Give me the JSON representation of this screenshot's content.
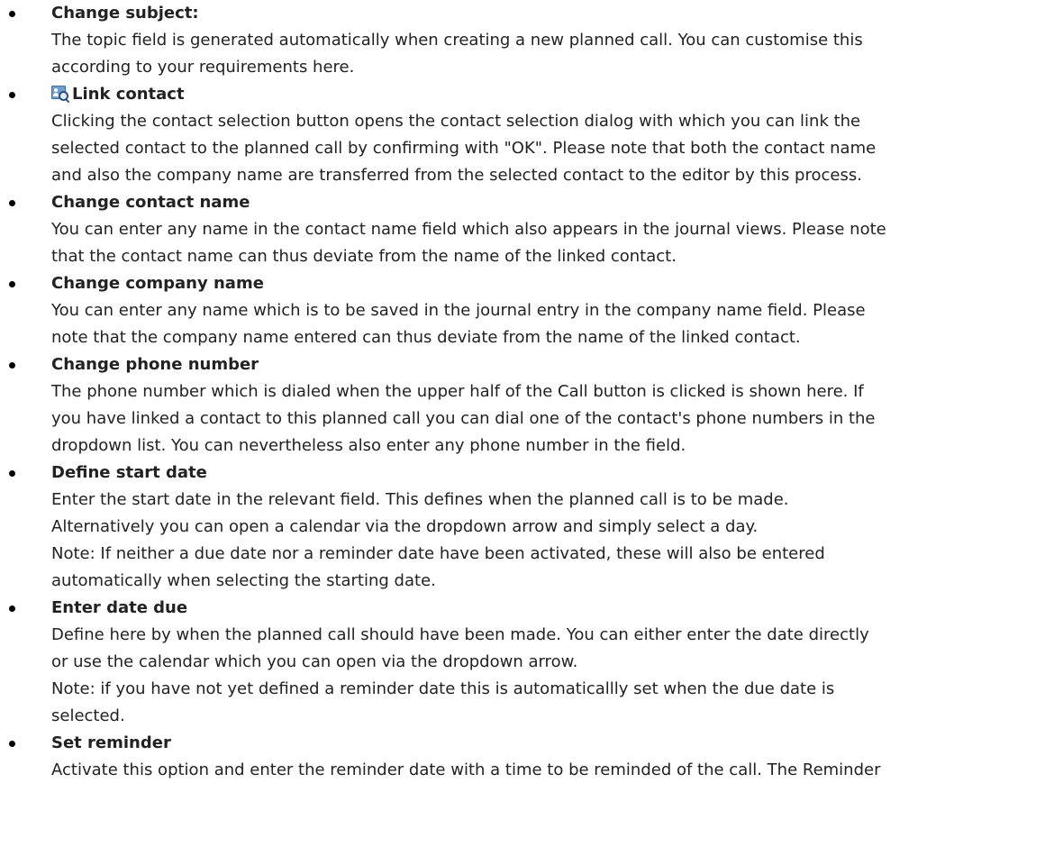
{
  "items": [
    {
      "title": "Change subject:",
      "lines": [
        "The topic field is generated automatically when creating a new planned call. You can customise this",
        "according to your requirements here."
      ]
    },
    {
      "title": "Link contact",
      "icon": "contact-search-icon",
      "lines": [
        "Clicking the contact selection button opens the contact selection dialog with which you can link the",
        "selected contact to the planned call by confirming with \"OK\". Please note that both the contact name",
        "and also the company name are transferred from the selected contact to the editor by this process."
      ]
    },
    {
      "title": "Change contact name",
      "lines": [
        "You can enter any name in the contact name field which also appears in the journal views. Please note",
        "that the contact name can thus deviate from the name of the linked contact."
      ]
    },
    {
      "title": "Change company name",
      "lines": [
        "You can enter any name which is to be saved in the journal entry in the company name field. Please",
        "note that the company name entered can thus deviate from the name of the linked contact."
      ]
    },
    {
      "title": "Change phone number",
      "lines": [
        "The phone number which is dialed when the upper half of the Call button is clicked is shown here. If",
        "you have linked a contact to this planned call you can dial one of the contact's phone numbers in the",
        "dropdown list. You can nevertheless also enter any phone number in the field."
      ]
    },
    {
      "title": "Define start date",
      "lines": [
        "Enter the start date in the relevant field. This defines when the planned call is to be made.",
        "Alternatively you can open a calendar via the dropdown arrow and simply select a day.",
        "Note: If neither a due date nor a reminder date have been activated, these will also be entered",
        "automatically when selecting the starting date."
      ]
    },
    {
      "title": "Enter date due",
      "lines": [
        "Define here by when the planned call should have been made. You can either enter the date directly",
        "or use the calendar which you can open via the dropdown arrow.",
        "Note: if you have not yet defined a reminder date this is automaticallly set when the due date is",
        "selected."
      ]
    },
    {
      "title": "Set reminder",
      "lines": [
        "Activate this option and enter the reminder date with a time to be reminded of the call. The Reminder"
      ]
    }
  ]
}
